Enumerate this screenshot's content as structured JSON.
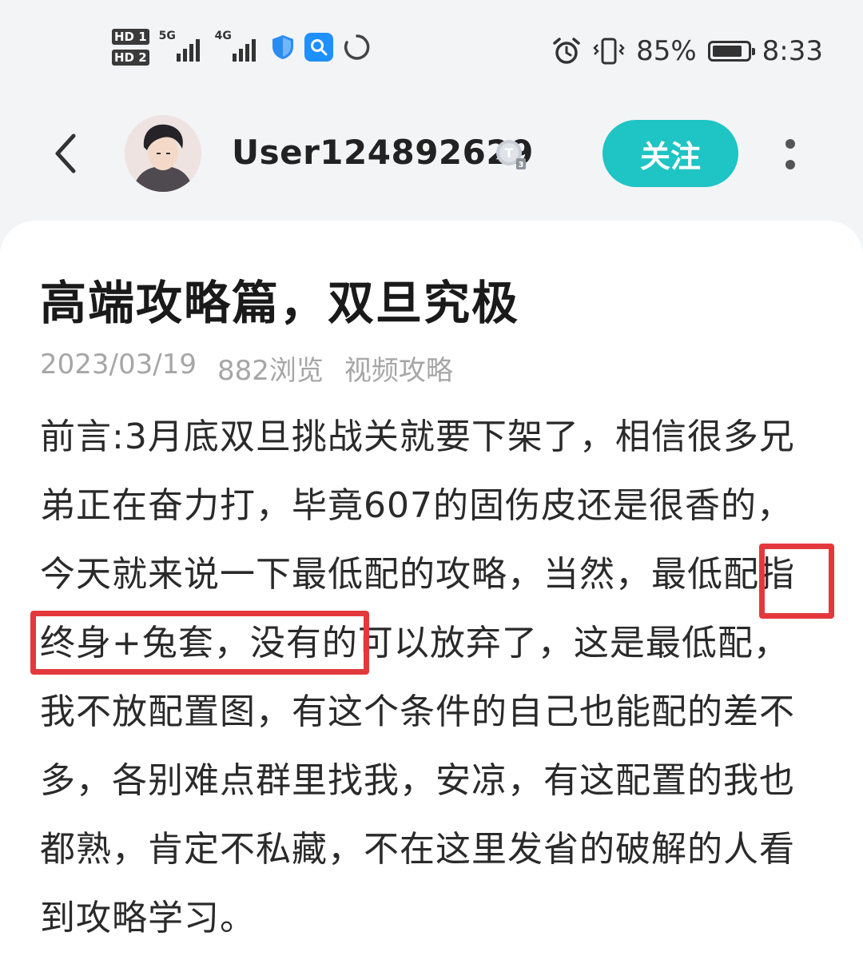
{
  "status_bar": {
    "hd1": "HD 1",
    "hd2": "HD 2",
    "net1": "5G",
    "net2": "4G",
    "battery_percent": "85%",
    "battery_level": 0.85,
    "time": "8:33",
    "icons": [
      "signal-5g-icon",
      "signal-4g-icon",
      "shield-icon",
      "search-app-icon",
      "loading-icon",
      "alarm-icon",
      "vibrate-icon",
      "battery-icon"
    ]
  },
  "header": {
    "username": "User124892629",
    "follow_label": "关注",
    "level_badge": "T3"
  },
  "article": {
    "title": "高端攻略篇，双旦究极",
    "date": "2023/03/19",
    "views": "882浏览",
    "category": "视频攻略",
    "body": "前言:3月底双旦挑战关就要下架了，相信很多兄弟正在奋力打，毕竟607的固伤皮还是很香的，今天就来说一下最低配的攻略，当然，最低配指终身+兔套，没有的可以放弃了，这是最低配，我不放配置图，有这个条件的自己也能配的差不多，各别难点群里找我，安凉，有这配置的我也都熟，肯定不私藏，不在这里发省的破解的人看到攻略学习。"
  },
  "colors": {
    "accent": "#1fc4c4",
    "highlight": "#e4393c",
    "background": "#f3f4f6"
  }
}
